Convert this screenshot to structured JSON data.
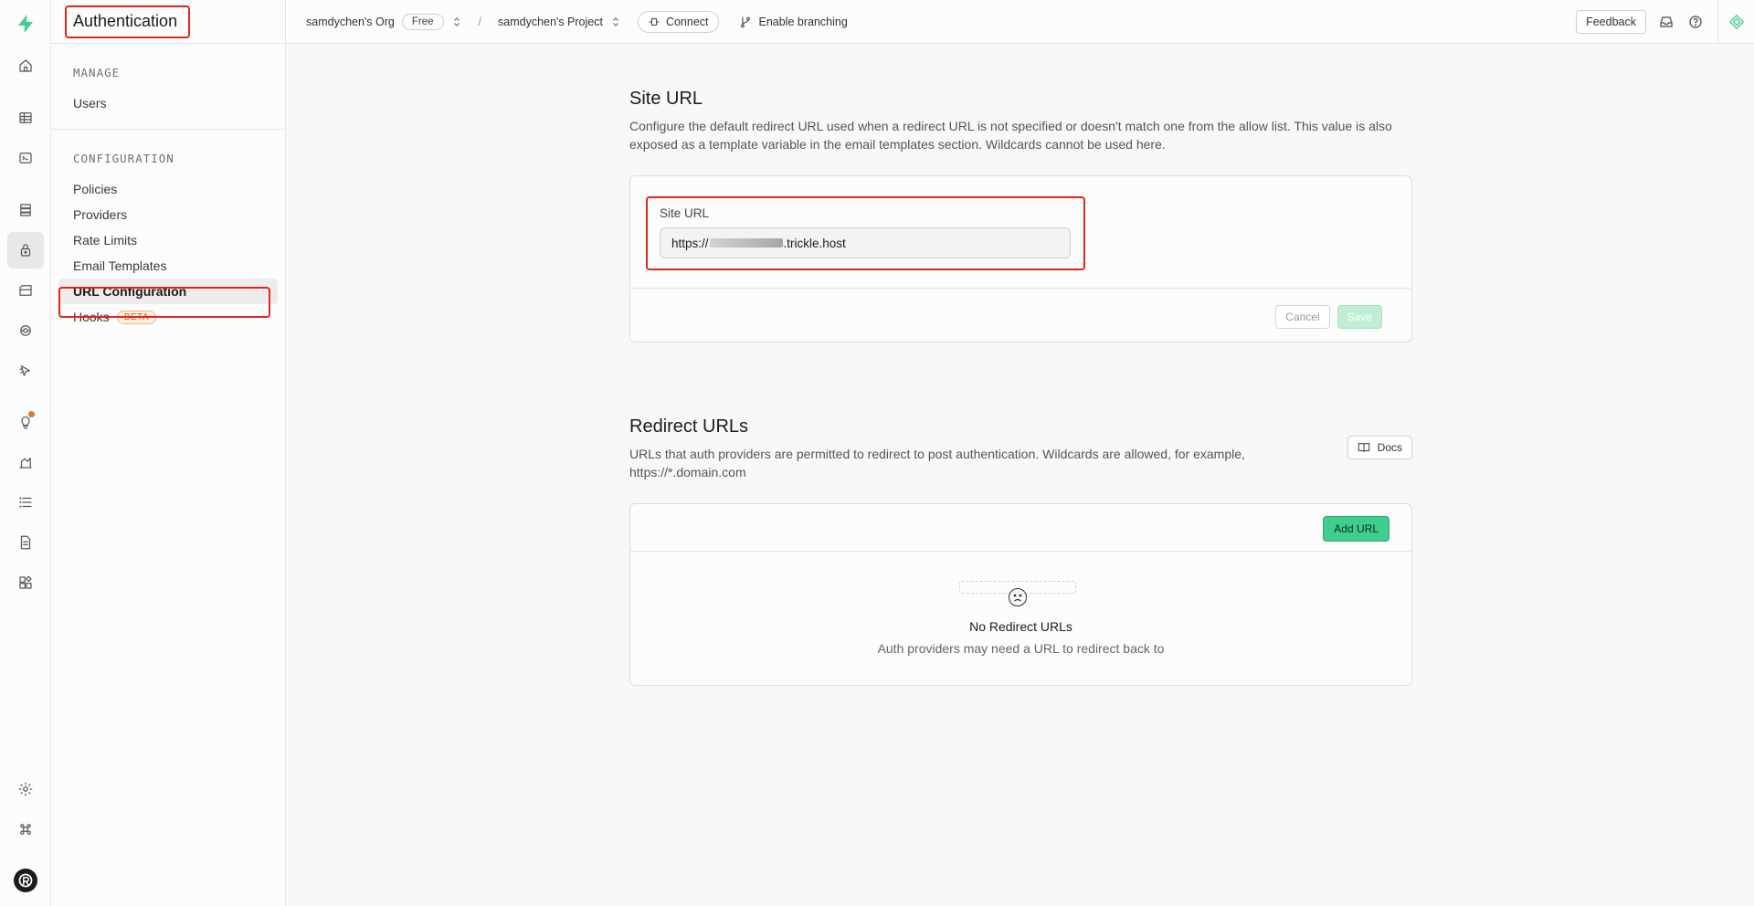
{
  "app": {
    "section_title": "Authentication"
  },
  "rail": {
    "icons": [
      "logo-bolt-icon",
      "home-icon",
      "table-editor-icon",
      "sql-editor-icon",
      "database-icon",
      "authentication-icon",
      "storage-icon",
      "realtime-icon",
      "edge-functions-icon",
      "advisors-icon",
      "reports-icon",
      "logs-icon",
      "api-docs-icon",
      "integrations-icon",
      "settings-icon",
      "command-icon",
      "user-avatar-icon"
    ],
    "brand_color": "#3ecf8e",
    "notification_color": "#e0782f"
  },
  "sidebar": {
    "manage_heading": "MANAGE",
    "manage_items": [
      "Users"
    ],
    "config_heading": "CONFIGURATION",
    "config_items": [
      "Policies",
      "Providers",
      "Rate Limits",
      "Email Templates",
      "URL Configuration",
      "Hooks"
    ],
    "active_item": "URL Configuration",
    "hooks_badge": "BETA"
  },
  "topbar": {
    "org_name": "samdychen's Org",
    "plan_badge": "Free",
    "separator": "/",
    "project_name": "samdychen's Project",
    "connect_label": "Connect",
    "branching_label": "Enable branching",
    "feedback_label": "Feedback",
    "right_icons": [
      "inbox-icon",
      "help-icon"
    ]
  },
  "site_url": {
    "title": "Site URL",
    "description": "Configure the default redirect URL used when a redirect URL is not specified or doesn't match one from the allow list. This value is also exposed as a template variable in the email templates section. Wildcards cannot be used here.",
    "field_label": "Site URL",
    "value_prefix": "https://",
    "value_suffix": ".trickle.host",
    "cancel_label": "Cancel",
    "save_label": "Save"
  },
  "redirect_urls": {
    "title": "Redirect URLs",
    "description": "URLs that auth providers are permitted to redirect to post authentication. Wildcards are allowed, for example, https://*.domain.com",
    "docs_label": "Docs",
    "add_label": "Add URL",
    "empty_title": "No Redirect URLs",
    "empty_subtitle": "Auth providers may need a URL to redirect back to"
  },
  "highlight_color": "#e0261a"
}
